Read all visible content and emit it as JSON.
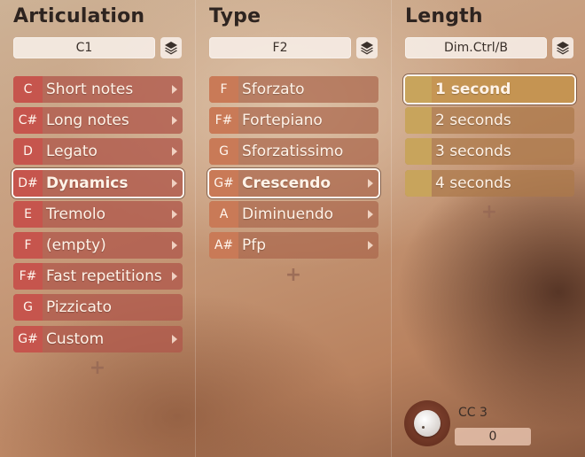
{
  "articulation": {
    "title": "Articulation",
    "selector_value": "C1",
    "icon": "layers-icon",
    "items": [
      {
        "key": "C",
        "label": "Short notes",
        "arrow": true
      },
      {
        "key": "C#",
        "label": "Long notes",
        "arrow": true
      },
      {
        "key": "D",
        "label": "Legato",
        "arrow": true
      },
      {
        "key": "D#",
        "label": "Dynamics",
        "arrow": true,
        "selected": true
      },
      {
        "key": "E",
        "label": "Tremolo",
        "arrow": true
      },
      {
        "key": "F",
        "label": "(empty)",
        "arrow": true
      },
      {
        "key": "F#",
        "label": "Fast repetitions",
        "arrow": true
      },
      {
        "key": "G",
        "label": "Pizzicato",
        "arrow": false
      },
      {
        "key": "G#",
        "label": "Custom",
        "arrow": true
      }
    ],
    "add_label": "+"
  },
  "type": {
    "title": "Type",
    "selector_value": "F2",
    "icon": "layers-icon",
    "items": [
      {
        "key": "F",
        "label": "Sforzato",
        "arrow": false
      },
      {
        "key": "F#",
        "label": "Fortepiano",
        "arrow": false
      },
      {
        "key": "G",
        "label": "Sforzatissimo",
        "arrow": false
      },
      {
        "key": "G#",
        "label": "Crescendo",
        "arrow": true,
        "selected": true
      },
      {
        "key": "A",
        "label": "Diminuendo",
        "arrow": true
      },
      {
        "key": "A#",
        "label": "Pfp",
        "arrow": true
      }
    ],
    "add_label": "+"
  },
  "length": {
    "title": "Length",
    "selector_value": "Dim.Ctrl/B",
    "icon": "layers-icon",
    "items": [
      {
        "label": "1 second",
        "selected": true
      },
      {
        "label": "2 seconds"
      },
      {
        "label": "3 seconds"
      },
      {
        "label": "4 seconds"
      }
    ],
    "add_label": "+"
  },
  "controller": {
    "label": "CC 3",
    "value": "0",
    "knob_level": 0
  }
}
